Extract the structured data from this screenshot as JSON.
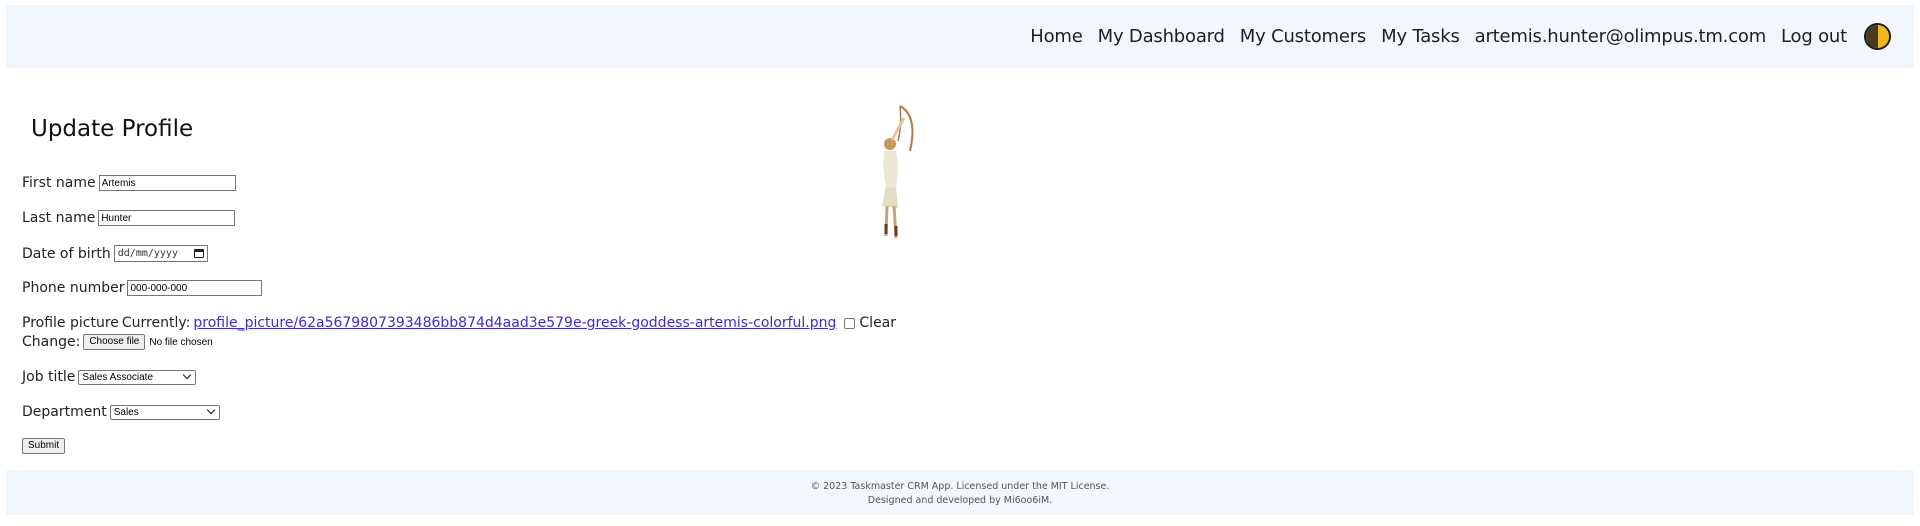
{
  "nav": {
    "items": [
      {
        "label": "Home"
      },
      {
        "label": "My Dashboard"
      },
      {
        "label": "My Customers"
      },
      {
        "label": "My Tasks"
      },
      {
        "label": "artemis.hunter@olimpus.tm.com"
      },
      {
        "label": "Log out"
      }
    ],
    "theme_toggle_icon": "half-moon-toggle-icon"
  },
  "page": {
    "title": "Update Profile"
  },
  "form": {
    "first_name": {
      "label": "First name",
      "value": "Artemis"
    },
    "last_name": {
      "label": "Last name",
      "value": "Hunter"
    },
    "dob": {
      "label": "Date of birth",
      "value": "dd/mm/yyyy"
    },
    "phone": {
      "label": "Phone number",
      "value": "000-000-000"
    },
    "picture": {
      "label": "Profile picture",
      "currently_label": "Currently:",
      "current_file": "profile_picture/62a5679807393486bb874d4aad3e579e-greek-goddess-artemis-colorful.png",
      "clear_label": "Clear",
      "change_label": "Change:",
      "choose_button": "Choose file",
      "no_file": "No file chosen"
    },
    "job_title": {
      "label": "Job title",
      "value": "Sales Associate"
    },
    "department": {
      "label": "Department",
      "value": "Sales"
    },
    "submit_label": "Submit"
  },
  "footer": {
    "line1": "© 2023 Taskmaster CRM App. Licensed under the MIT License.",
    "line2": "Designed and developed by Mi6oo6iM."
  },
  "colors": {
    "nav_background": "#f2f7fd",
    "link_color": "#3b2bd6"
  }
}
